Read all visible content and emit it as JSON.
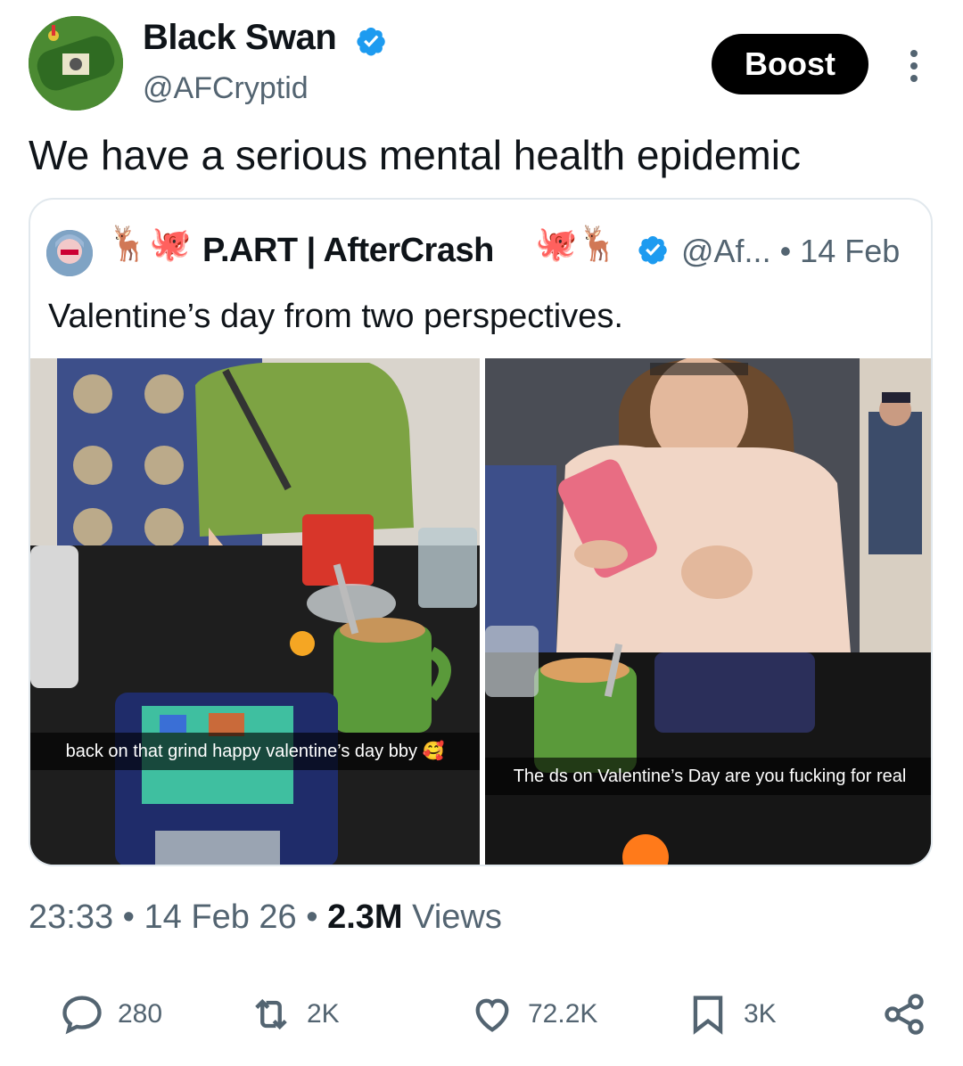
{
  "author": {
    "display_name": "Black Swan",
    "handle": "@AFCryptid"
  },
  "boost_label": "Boost",
  "tweet_text": "We have a serious mental health epidemic",
  "quote": {
    "deco_left": "🦌🐙",
    "display_name": "P.ART | AfterCrash",
    "deco_right": "🐙🦌",
    "handle_time": "@Af... • 14 Feb",
    "text": "Valentine’s day from two perspectives.",
    "media": [
      {
        "caption": "back on that grind happy valentine’s day bby 🥰"
      },
      {
        "caption": "The ds on Valentine’s Day are you fucking for real"
      }
    ]
  },
  "meta": {
    "time": "23:33",
    "date": "14 Feb 26",
    "views_count": "2.3M",
    "views_label": "Views",
    "separator": "•"
  },
  "actions": {
    "replies": "280",
    "reposts": "2K",
    "likes": "72.2K",
    "bookmarks": "3K"
  },
  "colors": {
    "verified": "#1d9bf0",
    "secondary_text": "#536471",
    "primary_text": "#0f1419",
    "boost_bg": "#000000"
  },
  "icons": [
    "verified-icon",
    "more-icon",
    "reply-icon",
    "repost-icon",
    "like-icon",
    "bookmark-icon",
    "share-icon"
  ]
}
